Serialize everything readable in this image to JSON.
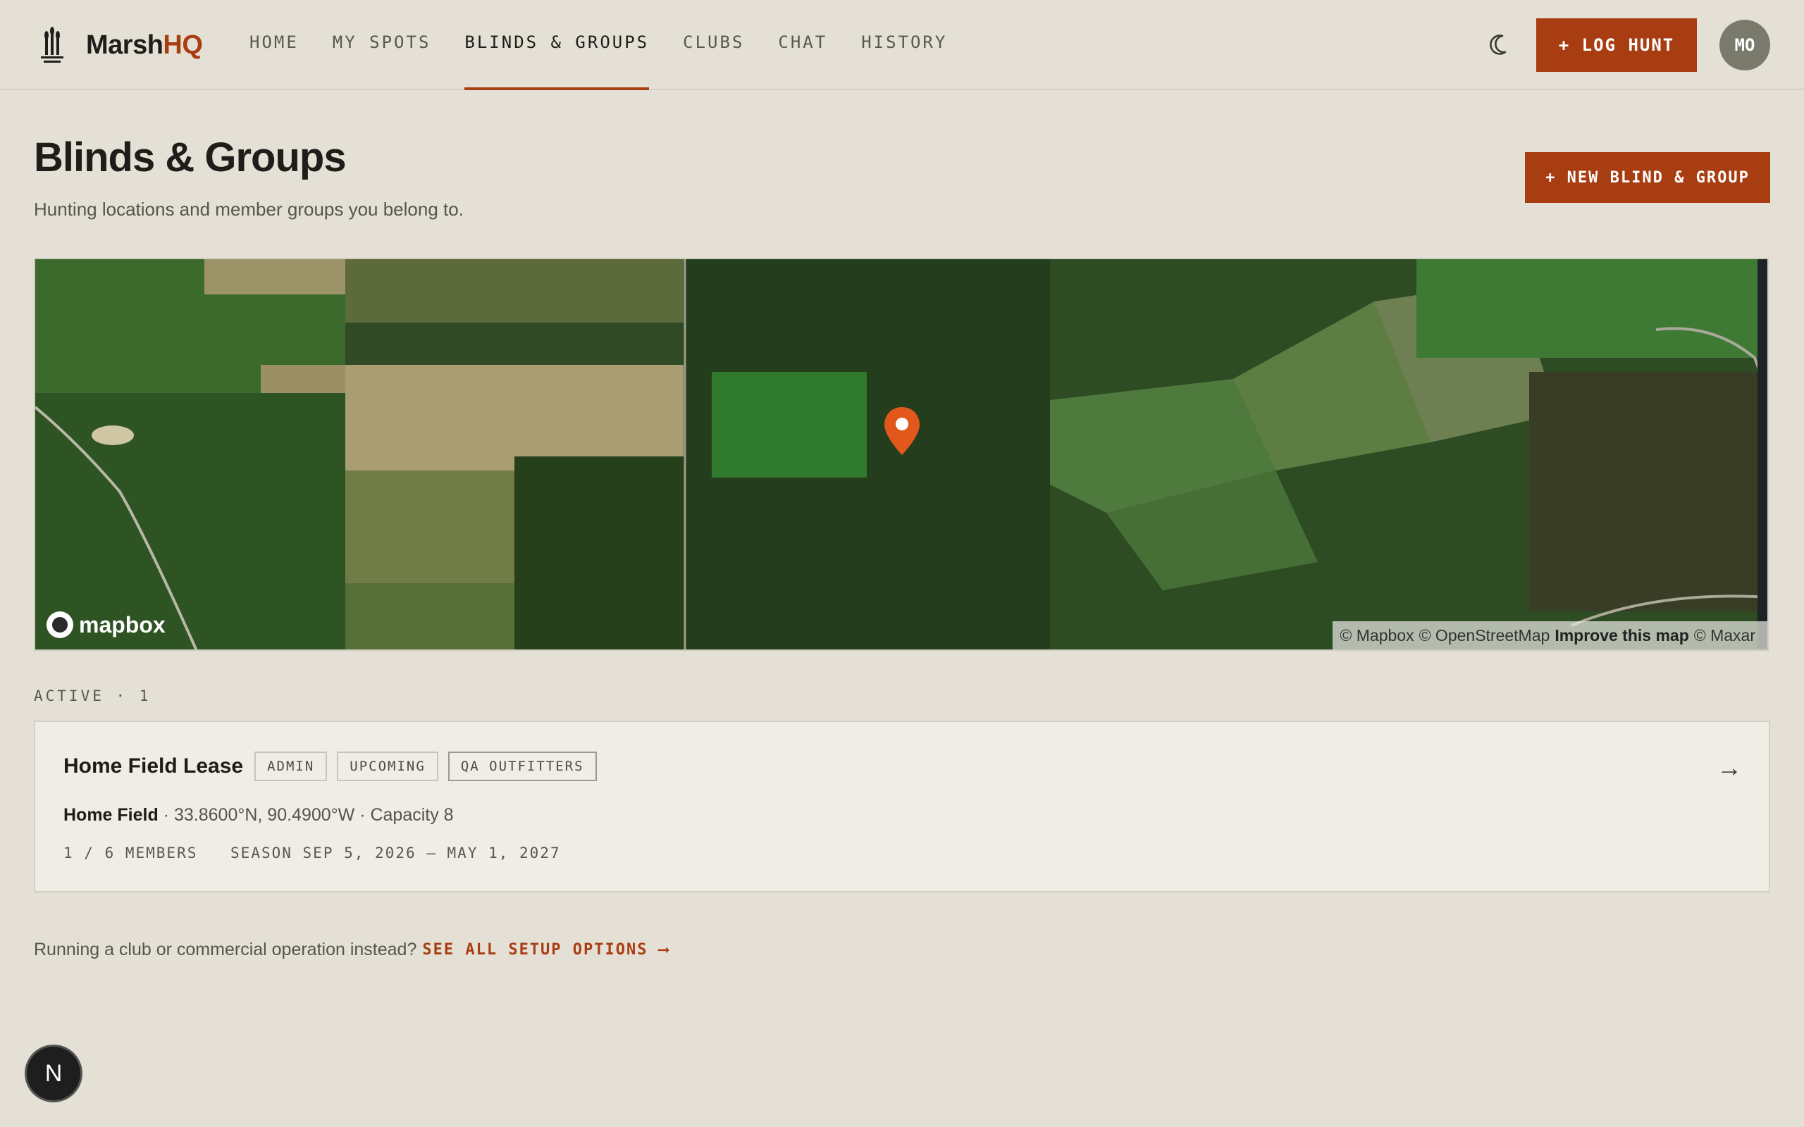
{
  "brand": {
    "part1": "Marsh",
    "part2": "HQ",
    "accent": "#a83d12"
  },
  "nav": {
    "links": [
      "HOME",
      "MY SPOTS",
      "BLINDS & GROUPS",
      "CLUBS",
      "CHAT",
      "HISTORY"
    ],
    "active": "BLINDS & GROUPS",
    "theme_icon": "moon-icon",
    "log_hunt_label": "+ LOG HUNT",
    "avatar_initials": "MO"
  },
  "header": {
    "title": "Blinds & Groups",
    "subtitle": "Hunting locations and member groups you belong to.",
    "new_button_label": "+ NEW BLIND & GROUP"
  },
  "map": {
    "logo_text": "mapbox",
    "attribution": {
      "mapbox": "© Mapbox",
      "osm": "© OpenStreetMap",
      "improve": "Improve this map",
      "maxar": "© Maxar"
    },
    "marker_icon": "map-pin-icon"
  },
  "active_section": {
    "label": "ACTIVE · 1",
    "cards": [
      {
        "title": "Home Field Lease",
        "tags": [
          "ADMIN",
          "UPCOMING",
          "QA OUTFITTERS"
        ],
        "location_name": "Home Field",
        "location_detail": "· 33.8600°N, 90.4900°W · Capacity 8",
        "members": "1 / 6 MEMBERS",
        "season": "SEASON SEP 5, 2026 – MAY 1, 2027",
        "arrow": "→"
      }
    ]
  },
  "footer": {
    "note": "Running a club or commercial operation instead?",
    "link_label": "SEE ALL SETUP OPTIONS ⟶"
  },
  "floating_button": {
    "label": "N"
  }
}
